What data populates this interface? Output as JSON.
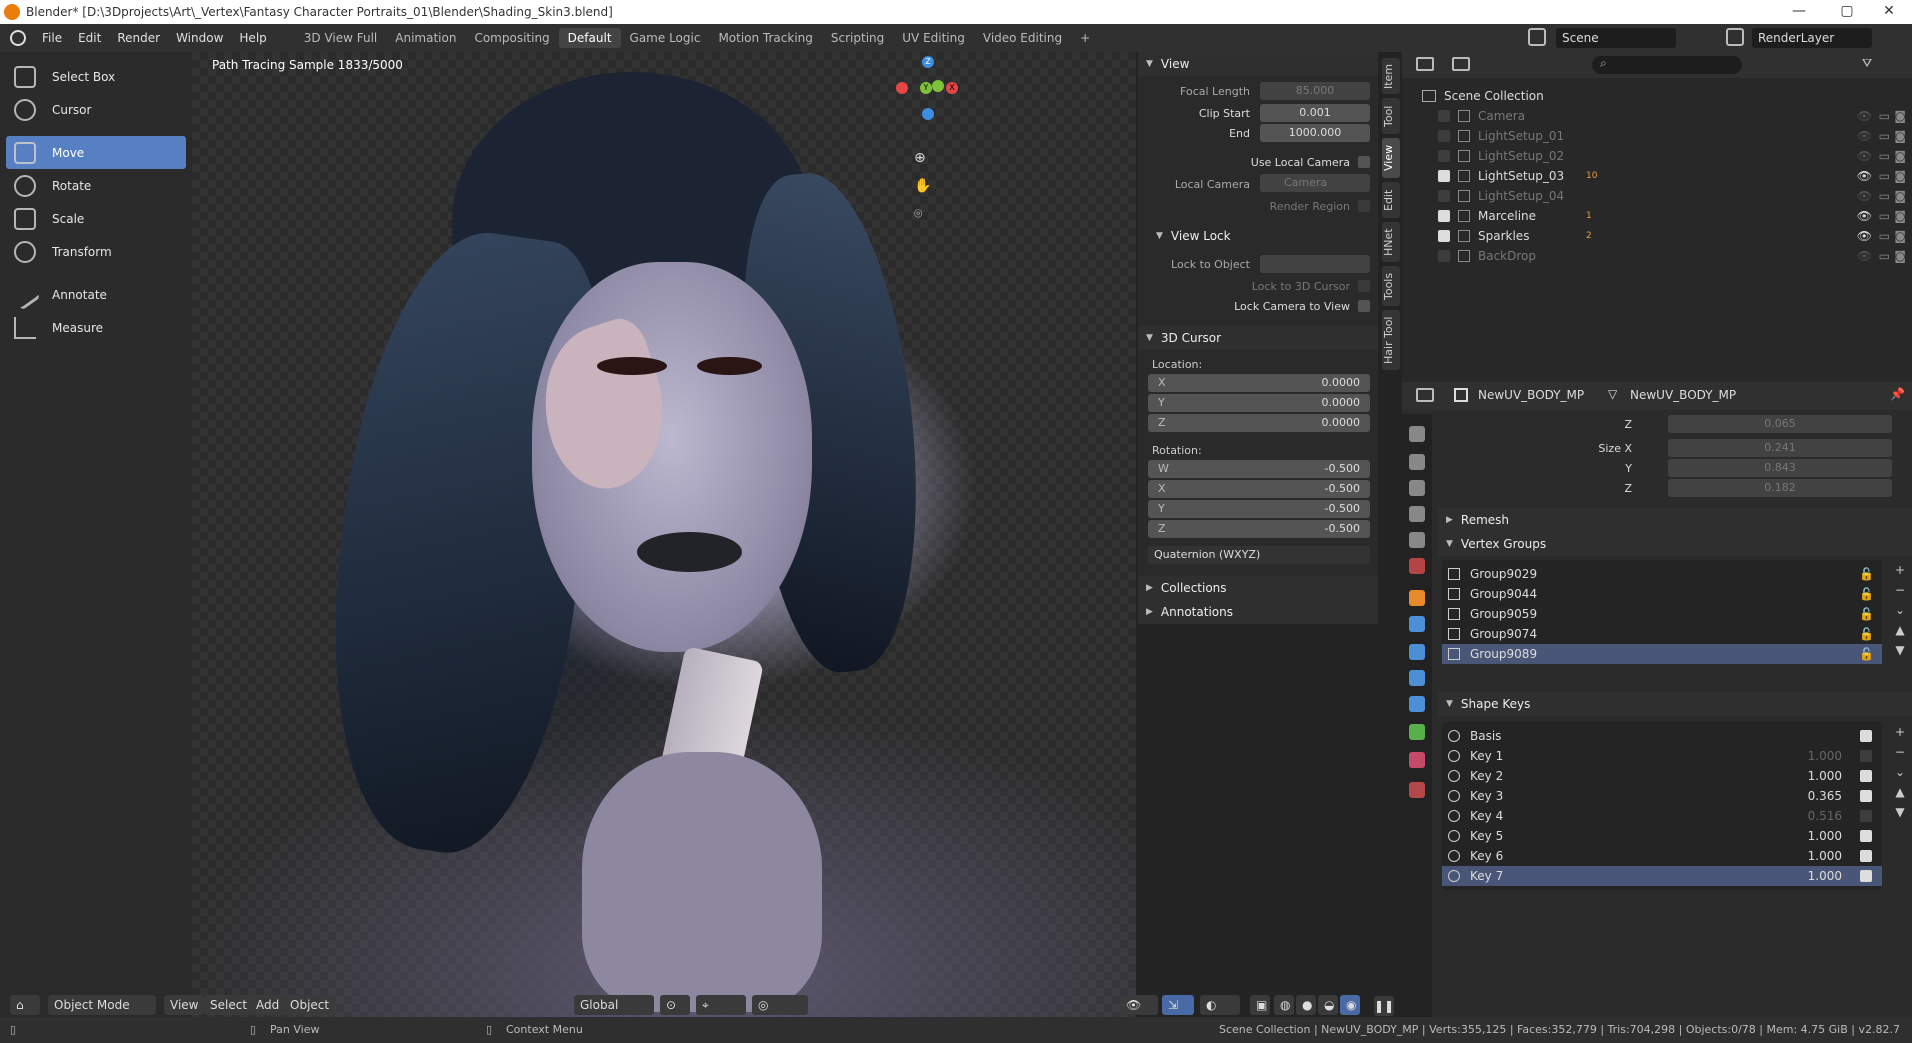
{
  "window": {
    "title": "Blender* [D:\\3Dprojects\\Art\\_Vertex\\Fantasy Character Portraits_01\\Blender\\Shading_Skin3.blend]",
    "min": "—",
    "max": "▢",
    "close": "✕"
  },
  "menu": [
    "File",
    "Edit",
    "Render",
    "Window",
    "Help"
  ],
  "workspaces": [
    "3D View Full",
    "Animation",
    "Compositing",
    "Default",
    "Game Logic",
    "Motion Tracking",
    "Scripting",
    "UV Editing",
    "Video Editing",
    "+"
  ],
  "active_workspace": "Default",
  "scene": {
    "scene_label": "Scene",
    "renderlayer_label": "RenderLayer"
  },
  "viewport": {
    "overlay_text": "Path Tracing Sample 1833/5000",
    "gizmo": {
      "x": "X",
      "y": "Y",
      "z": "Z"
    }
  },
  "tools": [
    "Select Box",
    "Cursor",
    "Move",
    "Rotate",
    "Scale",
    "Transform",
    "Annotate",
    "Measure"
  ],
  "active_tool": "Move",
  "sidetabs": [
    "Item",
    "Tool",
    "View",
    "Edit",
    "HNet",
    "Tools",
    "Hair Tool"
  ],
  "npanel": {
    "view_header": "View",
    "focal_length_label": "Focal Length",
    "focal_length": "85.000",
    "clip_start_label": "Clip Start",
    "clip_start": "0.001",
    "end_label": "End",
    "end": "1000.000",
    "use_local_camera": "Use Local Camera",
    "local_camera_label": "Local Camera",
    "local_camera": "Camera",
    "render_region": "Render Region",
    "view_lock_header": "View Lock",
    "lock_to_object": "Lock to Object",
    "lock_3d_cursor": "Lock to 3D Cursor",
    "lock_camera": "Lock Camera to View",
    "cursor_header": "3D Cursor",
    "location_label": "Location:",
    "loc": [
      {
        "axis": "X",
        "value": "0.0000"
      },
      {
        "axis": "Y",
        "value": "0.0000"
      },
      {
        "axis": "Z",
        "value": "0.0000"
      }
    ],
    "rotation_label": "Rotation:",
    "rot": [
      {
        "axis": "W",
        "value": "-0.500"
      },
      {
        "axis": "X",
        "value": "-0.500"
      },
      {
        "axis": "Y",
        "value": "-0.500"
      },
      {
        "axis": "Z",
        "value": "-0.500"
      }
    ],
    "rot_mode": "Quaternion (WXYZ)",
    "collections": "Collections",
    "annotations": "Annotations"
  },
  "outliner": {
    "root": "Scene Collection",
    "items": [
      {
        "name": "Camera",
        "dim": true,
        "checked": false
      },
      {
        "name": "LightSetup_01",
        "dim": true,
        "checked": false
      },
      {
        "name": "LightSetup_02",
        "dim": true,
        "checked": false
      },
      {
        "name": "LightSetup_03",
        "dim": false,
        "checked": true,
        "badge": "10"
      },
      {
        "name": "LightSetup_04",
        "dim": true,
        "checked": false
      },
      {
        "name": "Marceline",
        "dim": false,
        "checked": true,
        "badge": "1"
      },
      {
        "name": "Sparkles",
        "dim": false,
        "checked": true,
        "badge": "2"
      },
      {
        "name": "BackDrop",
        "dim": true,
        "checked": false
      }
    ]
  },
  "properties": {
    "object_name": "NewUV_BODY_MP",
    "mesh_name": "NewUV_BODY_MP",
    "z_label": "Z",
    "z_value": "0.065",
    "size_x_label": "Size X",
    "size_x": "0.241",
    "size_y_label": "Y",
    "size_y": "0.843",
    "size_z_label": "Z",
    "size_z": "0.182",
    "remesh": "Remesh",
    "vertex_groups_header": "Vertex Groups",
    "vertex_groups": [
      "Group9029",
      "Group9044",
      "Group9059",
      "Group9074",
      "Group9089"
    ],
    "shape_keys_header": "Shape Keys",
    "shape_keys": [
      {
        "name": "Basis",
        "value": "",
        "checked": true
      },
      {
        "name": "Key 1",
        "value": "1.000",
        "checked": false
      },
      {
        "name": "Key 2",
        "value": "1.000",
        "checked": true
      },
      {
        "name": "Key 3",
        "value": "0.365",
        "checked": true
      },
      {
        "name": "Key 4",
        "value": "0.516",
        "checked": false
      },
      {
        "name": "Key 5",
        "value": "1.000",
        "checked": true
      },
      {
        "name": "Key 6",
        "value": "1.000",
        "checked": true
      },
      {
        "name": "Key 7",
        "value": "1.000",
        "checked": true
      }
    ]
  },
  "viewport_header": {
    "mode": "Object Mode",
    "view": "View",
    "select": "Select",
    "add": "Add",
    "object": "Object",
    "orientation": "Global"
  },
  "status": {
    "pan": "Pan View",
    "context": "Context Menu",
    "stats": "Scene Collection | NewUV_BODY_MP | Verts:355,125 | Faces:352,779 | Tris:704,298 | Objects:0/78 | Mem: 4.75 GiB | v2.82.7"
  },
  "colors": {
    "accent": "#5680c2",
    "selected_row": "#4a5677",
    "x_axis": "#e54545",
    "y_axis": "#7ec23a",
    "z_axis": "#3d8ee0"
  }
}
